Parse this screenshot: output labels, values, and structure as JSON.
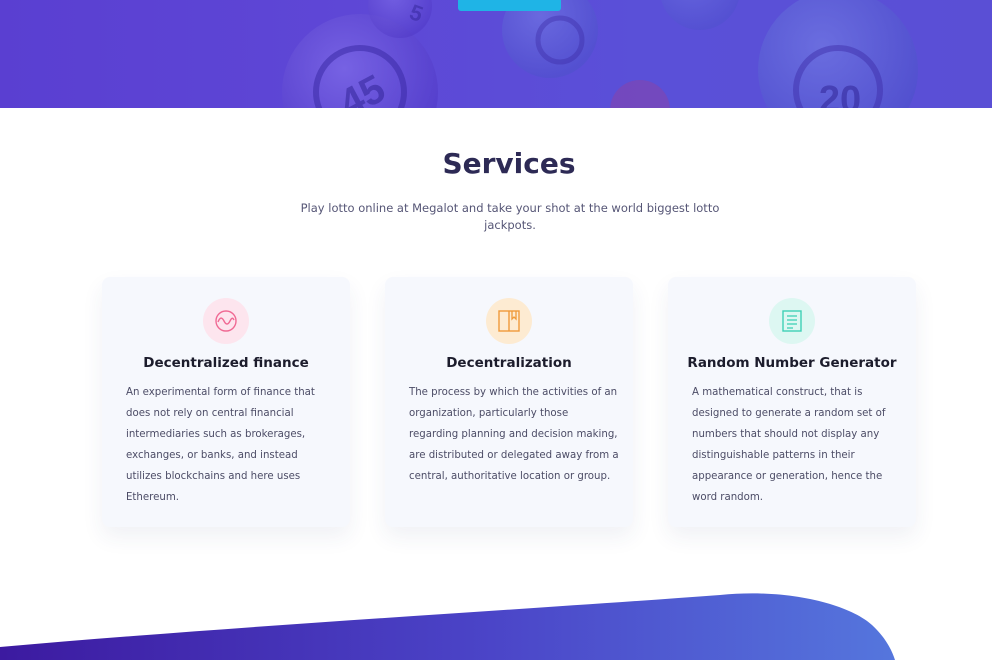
{
  "section": {
    "title": "Services",
    "subtitle": "Play lotto online at Megalot and take your shot at the world biggest lotto jackpots."
  },
  "cards": [
    {
      "title": "Decentralized finance",
      "description": "An experimental form of finance that does not rely on central financial intermediaries such as brokerages, exchanges, or banks, and instead utilizes blockchains and here uses Ethereum.",
      "icon": "wave-chart-icon",
      "icon_color": "#f06a94",
      "icon_bg": "#fde5ee"
    },
    {
      "title": "Decentralization",
      "description": "The process by which the activities of an organization, particularly those regarding planning and decision making, are distributed or delegated away from a central, authoritative location or group.",
      "icon": "book-icon",
      "icon_color": "#ef9a3a",
      "icon_bg": "#fdebd2"
    },
    {
      "title": "Random Number Generator",
      "description": "A mathematical construct, that is designed to generate a random set of numbers that should not display any distinguishable patterns in their appearance or generation, hence the word random.",
      "icon": "document-icon",
      "icon_color": "#3fd1b6",
      "icon_bg": "#ddf7f2"
    }
  ],
  "colors": {
    "hero_bg": "#5a48d4",
    "accent_button": "#1fb4e6",
    "title_text": "#2d2a55",
    "card_bg": "#f6f8fd",
    "wave_start": "#3c1aa0",
    "wave_end": "#5576dd"
  }
}
